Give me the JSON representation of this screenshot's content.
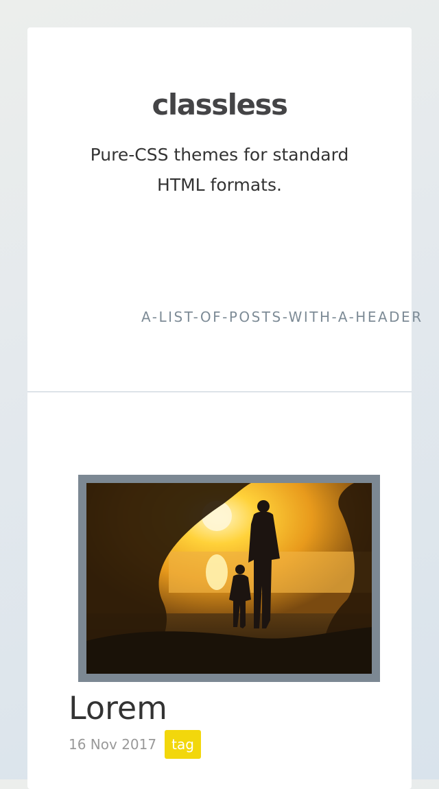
{
  "site": {
    "title": "classless",
    "tagline": "Pure-CSS themes for standard HTML formats.",
    "page_slug": "A-LIST-OF-POSTS-WITH-A-HEADER"
  },
  "post": {
    "title": "Lorem",
    "date": "16 Nov 2017",
    "tag": "tag",
    "image": "sunset-silhouette-photo"
  },
  "colors": {
    "tag_background": "#f2d70c",
    "image_frame": "#7c8893",
    "slug_text": "#7d8b96"
  }
}
